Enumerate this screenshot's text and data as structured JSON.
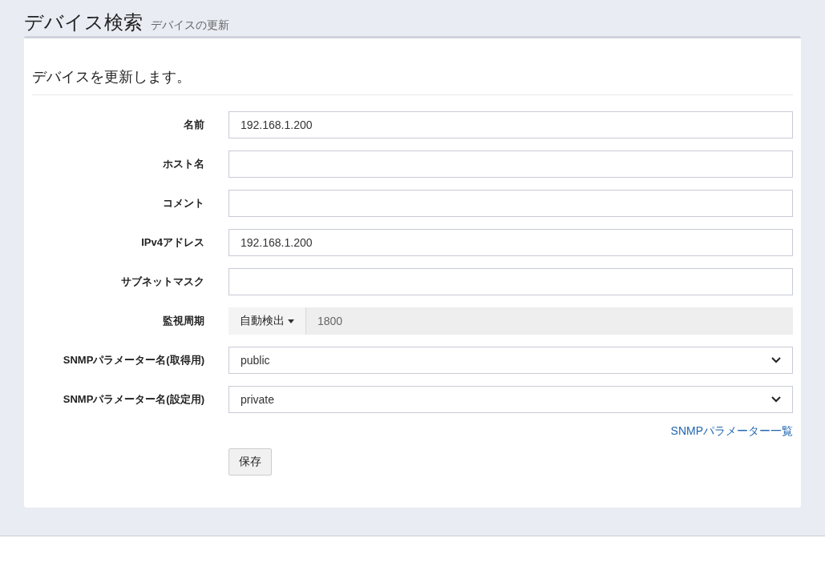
{
  "header": {
    "title": "デバイス検索",
    "subtitle": "デバイスの更新"
  },
  "card": {
    "lead": "デバイスを更新します。",
    "fields": [
      {
        "kind": "text",
        "label": "名前",
        "value": "192.168.1.200"
      },
      {
        "kind": "text",
        "label": "ホスト名"
      },
      {
        "kind": "text",
        "label": "コメント"
      },
      {
        "kind": "text",
        "label": "IPv4アドレス",
        "value": "192.168.1.200"
      },
      {
        "kind": "text",
        "label": "サブネットマスク"
      },
      {
        "kind": "addon",
        "label": "監視周期",
        "addon": "自動検出",
        "value": "1800",
        "disabled": true
      },
      {
        "kind": "select",
        "label": "SNMPパラメーター名(取得用)",
        "value": "public"
      },
      {
        "kind": "select",
        "label": "SNMPパラメーター名(設定用)",
        "value": "private"
      }
    ],
    "link": "SNMPパラメーター一覧",
    "button": "保存"
  }
}
